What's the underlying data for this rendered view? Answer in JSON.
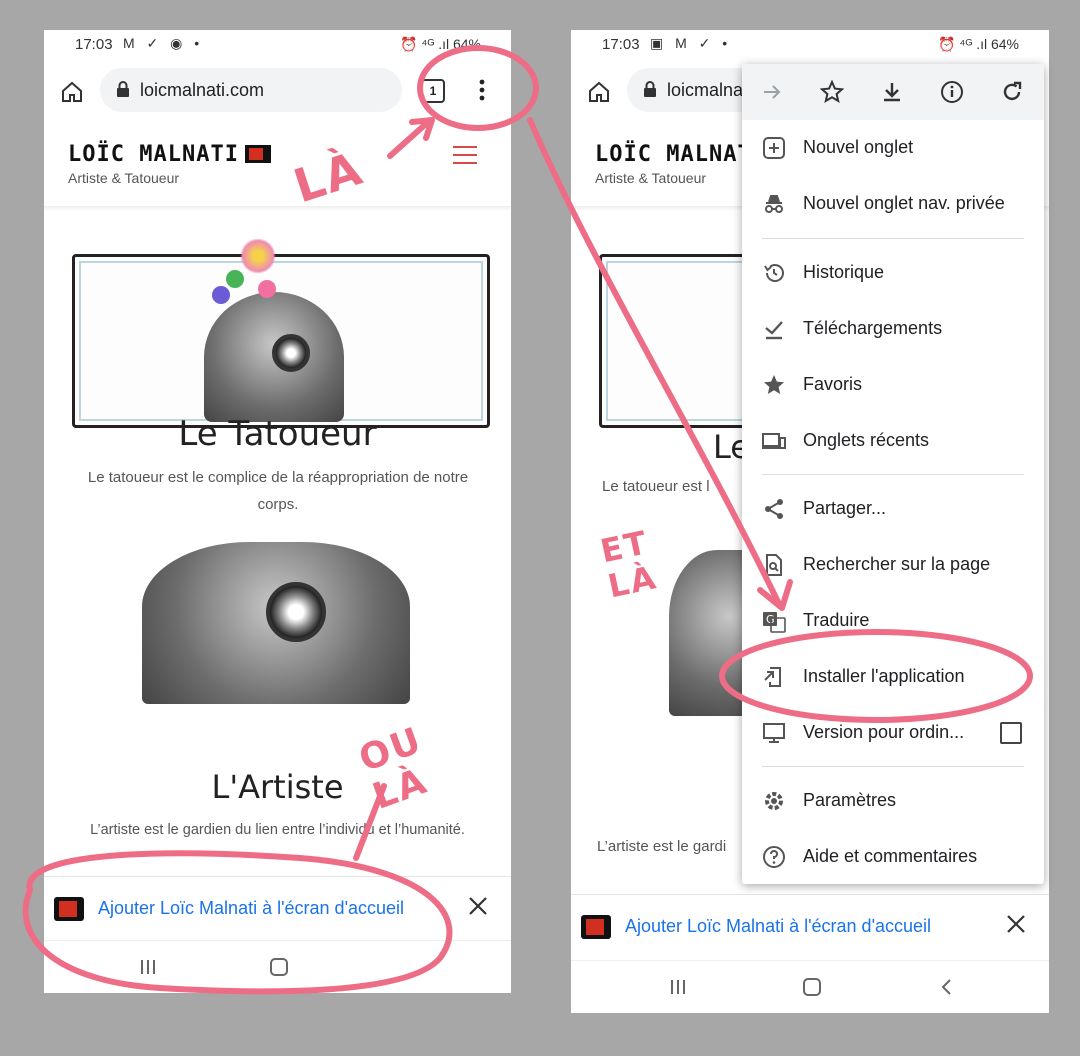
{
  "left_phone": {
    "status": {
      "time": "17:03",
      "icons": "M ✓ ◉ •",
      "right": "⏰ ⁴ᴳ .ıl 64%"
    },
    "url": "loicmalnati.com",
    "tab_count": "1",
    "site": {
      "name": "LOÏC MALNATI",
      "tagline": "Artiste & Tatoueur"
    },
    "section1": {
      "title": "Le Tatoueur",
      "text": "Le tatoueur est le complice de la réappropriation de notre corps."
    },
    "section2": {
      "title": "L'Artiste",
      "text": "L’artiste est le gardien du lien entre l’individu et l’humanité."
    },
    "banner": "Ajouter Loïc Malnati à l'écran d'accueil"
  },
  "right_phone": {
    "status": {
      "time": "17:03",
      "icons": "▣ M ✓ •",
      "right": "⏰ ⁴ᴳ .ıl 64%"
    },
    "url": "loicmalna",
    "site": {
      "name": "LOÏC MALNATI",
      "tagline": "Artiste & Tatoueur"
    },
    "section1_title": "Le",
    "section1_text": "Le tatoueur est l",
    "section2_text": "L’artiste est le gardi",
    "banner": "Ajouter Loïc Malnati à l'écran d'accueil"
  },
  "menu": {
    "items": [
      {
        "label": "Nouvel onglet",
        "icon": "plus-box-icon"
      },
      {
        "label": "Nouvel onglet nav. privée",
        "icon": "incognito-icon"
      },
      {
        "label": "Historique",
        "icon": "history-icon"
      },
      {
        "label": "Téléchargements",
        "icon": "download-check-icon"
      },
      {
        "label": "Favoris",
        "icon": "star-icon"
      },
      {
        "label": "Onglets récents",
        "icon": "devices-icon"
      },
      {
        "label": "Partager...",
        "icon": "share-icon"
      },
      {
        "label": "Rechercher sur la page",
        "icon": "find-in-page-icon"
      },
      {
        "label": "Traduire",
        "icon": "translate-icon"
      },
      {
        "label": "Installer l'application",
        "icon": "install-app-icon"
      },
      {
        "label": "Version pour ordin...",
        "icon": "desktop-icon"
      },
      {
        "label": "Paramètres",
        "icon": "gear-icon"
      },
      {
        "label": "Aide et commentaires",
        "icon": "help-icon"
      }
    ]
  },
  "annotations": {
    "la_top": "LÀ",
    "et_la": "ET LÀ",
    "ou_la": "OU LÀ"
  },
  "colors": {
    "annotation": "#ee6d86",
    "link": "#1a73e8",
    "brand_red": "#d12f1f"
  }
}
